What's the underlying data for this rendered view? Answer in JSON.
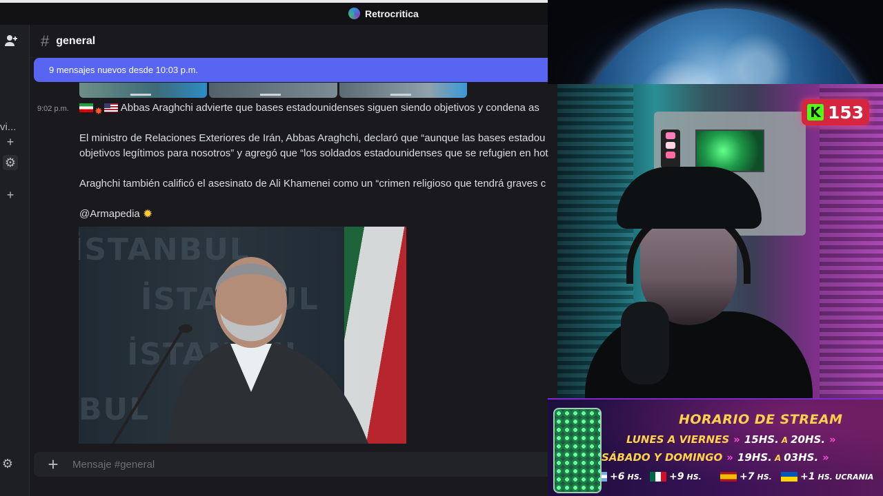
{
  "window": {
    "app_title": "Retrocritica"
  },
  "rail": {
    "partial_text": "vi..."
  },
  "channel": {
    "name": "general",
    "hash": "#"
  },
  "banner": {
    "text": "9 mensajes nuevos desde 10:03 p.m."
  },
  "message": {
    "timestamp": "9:02 p.m.",
    "headline": "Abbas Araghchi advierte que bases estadounidenses siguen siendo objetivos y condena as",
    "paragraph1_line1": "El ministro de Relaciones Exteriores de Irán, Abbas Araghchi, declaró que “aunque las bases estadou",
    "paragraph1_line2": "objetivos legítimos para nosotros” y agregó que “los soldados estadounidenses que se refugien en hot",
    "paragraph2": "Araghchi también calificó el asesinato de Ali Khamenei como un “crimen religioso que tendrá graves c",
    "credit": "@Armapedia",
    "photo_bg_text": [
      "İSTANBUL",
      "İSTANBUL",
      "İSTANBUL",
      "BUL"
    ]
  },
  "composer": {
    "placeholder": "Mensaje #general"
  },
  "stream": {
    "kick_count": "153",
    "schedule": {
      "title": "HORARIO DE STREAM",
      "rows": [
        {
          "day": "LUNES A VIERNES",
          "from": "15HS.",
          "sep": "A",
          "to": "20HS."
        },
        {
          "day": "SÁBADO Y DOMINGO",
          "from": "19HS.",
          "sep": "A",
          "to": "03HS."
        }
      ],
      "offsets": [
        {
          "label": "+6",
          "unit": "HS."
        },
        {
          "label": "+9",
          "unit": "HS."
        },
        {
          "label": "+7",
          "unit": "HS."
        },
        {
          "label": "+1",
          "unit": "HS. UCRANIA"
        }
      ]
    }
  }
}
